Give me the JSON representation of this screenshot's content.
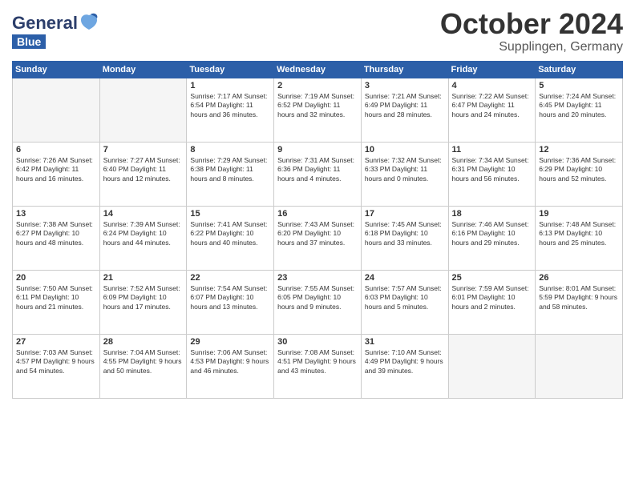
{
  "header": {
    "logo_line1": "General",
    "logo_line2": "Blue",
    "month": "October 2024",
    "location": "Supplingen, Germany"
  },
  "weekdays": [
    "Sunday",
    "Monday",
    "Tuesday",
    "Wednesday",
    "Thursday",
    "Friday",
    "Saturday"
  ],
  "weeks": [
    [
      {
        "day": "",
        "empty": true
      },
      {
        "day": "",
        "empty": true
      },
      {
        "day": "1",
        "info": "Sunrise: 7:17 AM\nSunset: 6:54 PM\nDaylight: 11 hours\nand 36 minutes."
      },
      {
        "day": "2",
        "info": "Sunrise: 7:19 AM\nSunset: 6:52 PM\nDaylight: 11 hours\nand 32 minutes."
      },
      {
        "day": "3",
        "info": "Sunrise: 7:21 AM\nSunset: 6:49 PM\nDaylight: 11 hours\nand 28 minutes."
      },
      {
        "day": "4",
        "info": "Sunrise: 7:22 AM\nSunset: 6:47 PM\nDaylight: 11 hours\nand 24 minutes."
      },
      {
        "day": "5",
        "info": "Sunrise: 7:24 AM\nSunset: 6:45 PM\nDaylight: 11 hours\nand 20 minutes."
      }
    ],
    [
      {
        "day": "6",
        "info": "Sunrise: 7:26 AM\nSunset: 6:42 PM\nDaylight: 11 hours\nand 16 minutes."
      },
      {
        "day": "7",
        "info": "Sunrise: 7:27 AM\nSunset: 6:40 PM\nDaylight: 11 hours\nand 12 minutes."
      },
      {
        "day": "8",
        "info": "Sunrise: 7:29 AM\nSunset: 6:38 PM\nDaylight: 11 hours\nand 8 minutes."
      },
      {
        "day": "9",
        "info": "Sunrise: 7:31 AM\nSunset: 6:36 PM\nDaylight: 11 hours\nand 4 minutes."
      },
      {
        "day": "10",
        "info": "Sunrise: 7:32 AM\nSunset: 6:33 PM\nDaylight: 11 hours\nand 0 minutes."
      },
      {
        "day": "11",
        "info": "Sunrise: 7:34 AM\nSunset: 6:31 PM\nDaylight: 10 hours\nand 56 minutes."
      },
      {
        "day": "12",
        "info": "Sunrise: 7:36 AM\nSunset: 6:29 PM\nDaylight: 10 hours\nand 52 minutes."
      }
    ],
    [
      {
        "day": "13",
        "info": "Sunrise: 7:38 AM\nSunset: 6:27 PM\nDaylight: 10 hours\nand 48 minutes."
      },
      {
        "day": "14",
        "info": "Sunrise: 7:39 AM\nSunset: 6:24 PM\nDaylight: 10 hours\nand 44 minutes."
      },
      {
        "day": "15",
        "info": "Sunrise: 7:41 AM\nSunset: 6:22 PM\nDaylight: 10 hours\nand 40 minutes."
      },
      {
        "day": "16",
        "info": "Sunrise: 7:43 AM\nSunset: 6:20 PM\nDaylight: 10 hours\nand 37 minutes."
      },
      {
        "day": "17",
        "info": "Sunrise: 7:45 AM\nSunset: 6:18 PM\nDaylight: 10 hours\nand 33 minutes."
      },
      {
        "day": "18",
        "info": "Sunrise: 7:46 AM\nSunset: 6:16 PM\nDaylight: 10 hours\nand 29 minutes."
      },
      {
        "day": "19",
        "info": "Sunrise: 7:48 AM\nSunset: 6:13 PM\nDaylight: 10 hours\nand 25 minutes."
      }
    ],
    [
      {
        "day": "20",
        "info": "Sunrise: 7:50 AM\nSunset: 6:11 PM\nDaylight: 10 hours\nand 21 minutes."
      },
      {
        "day": "21",
        "info": "Sunrise: 7:52 AM\nSunset: 6:09 PM\nDaylight: 10 hours\nand 17 minutes."
      },
      {
        "day": "22",
        "info": "Sunrise: 7:54 AM\nSunset: 6:07 PM\nDaylight: 10 hours\nand 13 minutes."
      },
      {
        "day": "23",
        "info": "Sunrise: 7:55 AM\nSunset: 6:05 PM\nDaylight: 10 hours\nand 9 minutes."
      },
      {
        "day": "24",
        "info": "Sunrise: 7:57 AM\nSunset: 6:03 PM\nDaylight: 10 hours\nand 5 minutes."
      },
      {
        "day": "25",
        "info": "Sunrise: 7:59 AM\nSunset: 6:01 PM\nDaylight: 10 hours\nand 2 minutes."
      },
      {
        "day": "26",
        "info": "Sunrise: 8:01 AM\nSunset: 5:59 PM\nDaylight: 9 hours\nand 58 minutes."
      }
    ],
    [
      {
        "day": "27",
        "info": "Sunrise: 7:03 AM\nSunset: 4:57 PM\nDaylight: 9 hours\nand 54 minutes."
      },
      {
        "day": "28",
        "info": "Sunrise: 7:04 AM\nSunset: 4:55 PM\nDaylight: 9 hours\nand 50 minutes."
      },
      {
        "day": "29",
        "info": "Sunrise: 7:06 AM\nSunset: 4:53 PM\nDaylight: 9 hours\nand 46 minutes."
      },
      {
        "day": "30",
        "info": "Sunrise: 7:08 AM\nSunset: 4:51 PM\nDaylight: 9 hours\nand 43 minutes."
      },
      {
        "day": "31",
        "info": "Sunrise: 7:10 AM\nSunset: 4:49 PM\nDaylight: 9 hours\nand 39 minutes."
      },
      {
        "day": "",
        "empty": true
      },
      {
        "day": "",
        "empty": true
      }
    ]
  ]
}
